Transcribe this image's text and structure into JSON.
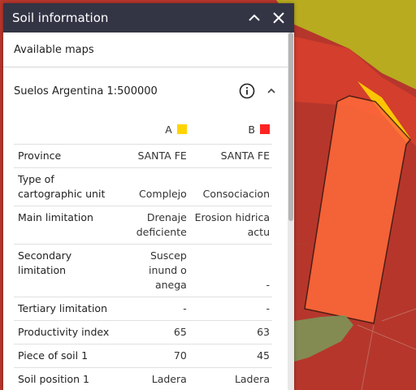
{
  "panel": {
    "title": "Soil information",
    "available_maps": "Available maps",
    "map_name": "Suelos Argentina 1:500000"
  },
  "colors": {
    "A": "#FFD400",
    "B": "#FF2222",
    "header": "#333545"
  },
  "table": {
    "col_a": "A",
    "col_b": "B",
    "rows": [
      {
        "label": "Province",
        "a": "SANTA FE",
        "b": "SANTA FE"
      },
      {
        "label": "Type of cartographic unit",
        "a": "Complejo",
        "b": "Consociacion"
      },
      {
        "label": "Main limitation",
        "a": "Drenaje deficiente",
        "b": "Erosion hidrica actu"
      },
      {
        "label": "Secondary limitation",
        "a": "Suscep inund o anega",
        "b": "-"
      },
      {
        "label": "Tertiary limitation",
        "a": "-",
        "b": "-"
      },
      {
        "label": "Productivity index",
        "a": "65",
        "b": "63"
      },
      {
        "label": "Piece of soil 1",
        "a": "70",
        "b": "45"
      },
      {
        "label": "Soil position 1",
        "a": "Ladera",
        "b": "Ladera"
      }
    ]
  }
}
